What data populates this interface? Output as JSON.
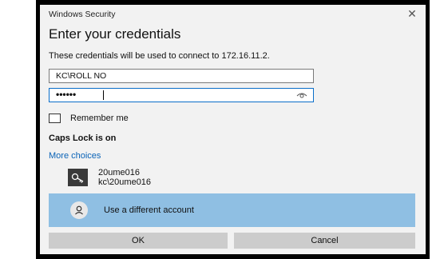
{
  "window": {
    "title": "Windows Security",
    "close_glyph": "✕"
  },
  "dialog": {
    "heading": "Enter your credentials",
    "subtitle": "These credentials will be used to connect to 172.16.11.2."
  },
  "form": {
    "username_value": "KC\\ROLL NO",
    "password_masked": "••••••",
    "remember_label": "Remember me",
    "remember_checked": false
  },
  "status": {
    "caps_lock": "Caps Lock is on"
  },
  "more_choices": {
    "link_label": "More choices",
    "account": {
      "name": "20ume016",
      "domain_user": "kc\\20ume016",
      "icon": "key-icon"
    },
    "use_different": {
      "label": "Use a different account",
      "icon": "person-icon"
    }
  },
  "buttons": {
    "ok": "OK",
    "cancel": "Cancel"
  },
  "colors": {
    "accent": "#0a63b7",
    "selected_option_bg": "#8fbfe3",
    "button_bg": "#cccccc",
    "dialog_bg": "#f2f2f2"
  }
}
